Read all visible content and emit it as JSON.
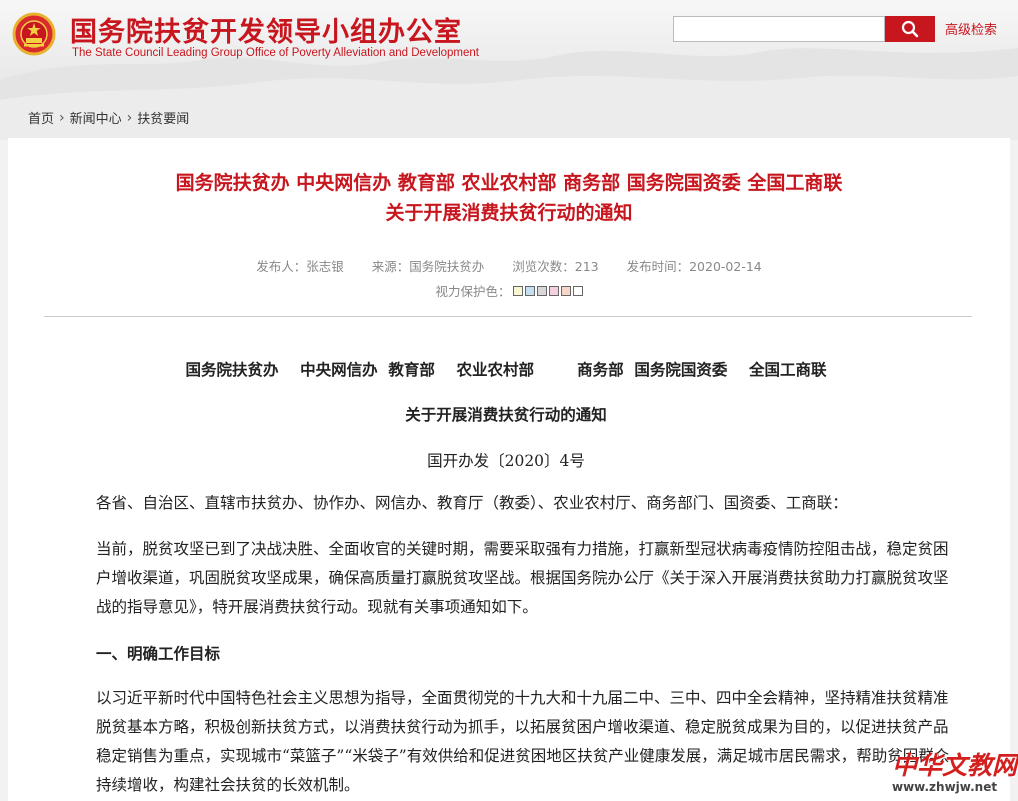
{
  "header": {
    "title": "国务院扶贫开发领导小组办公室",
    "subtitle": "The State Council Leading Group Office of Poverty Alleviation and Development",
    "emblem_icon": "national-emblem-icon",
    "search": {
      "placeholder": "",
      "button_icon": "search-icon"
    },
    "advanced_search_label": "高级检索",
    "brand_color": "#c8161e"
  },
  "breadcrumb": {
    "items": [
      "首页",
      "新闻中心",
      "扶贫要闻"
    ],
    "separator_icon": "chevron-right-icon"
  },
  "article": {
    "headline_line1": "国务院扶贫办 中央网信办 教育部 农业农村部 商务部 国务院国资委 全国工商联",
    "headline_line2": "关于开展消费扶贫行动的通知",
    "meta": {
      "publisher": "发布人：张志银",
      "source": "来源：国务院扶贫办",
      "views": "浏览次数：213",
      "date": "发布时间：2020-02-14"
    },
    "vision_label": "视力保护色：",
    "vision_colors": [
      "#faf6d4",
      "#c4e0f0",
      "#d8d8d8",
      "#f4cfe0",
      "#f6d6c8",
      "#ffffff"
    ],
    "body": {
      "issuers": "国务院扶贫办    中央网信办  教育部    农业农村部        商务部  国务院国资委    全国工商联",
      "title": "关于开展消费扶贫行动的通知",
      "doc_number": "国开办发〔2020〕4号",
      "salutation": "各省、自治区、直辖市扶贫办、协作办、网信办、教育厅（教委）、农业农村厅、商务部门、国资委、工商联：",
      "para1": "当前，脱贫攻坚已到了决战决胜、全面收官的关键时期，需要采取强有力措施，打赢新型冠状病毒疫情防控阻击战，稳定贫困户增收渠道，巩固脱贫攻坚成果，确保高质量打赢脱贫攻坚战。根据国务院办公厅《关于深入开展消费扶贫助力打赢脱贫攻坚战的指导意见》，特开展消费扶贫行动。现就有关事项通知如下。",
      "section1_heading": "一、明确工作目标",
      "para2": "以习近平新时代中国特色社会主义思想为指导，全面贯彻党的十九大和十九届二中、三中、四中全会精神，坚持精准扶贫精准脱贫基本方略，积极创新扶贫方式，以消费扶贫行动为抓手，以拓展贫困户增收渠道、稳定脱贫成果为目的，以促进扶贫产品稳定销售为重点，实现城市“菜篮子”“米袋子”有效供给和促进贫困地区扶贫产业健康发展，满足城市居民需求，帮助贫困群众持续增收，构建社会扶贫的长效机制。"
    }
  },
  "watermark": {
    "text": "中华文教网",
    "url": "www.zhwjw.net"
  }
}
